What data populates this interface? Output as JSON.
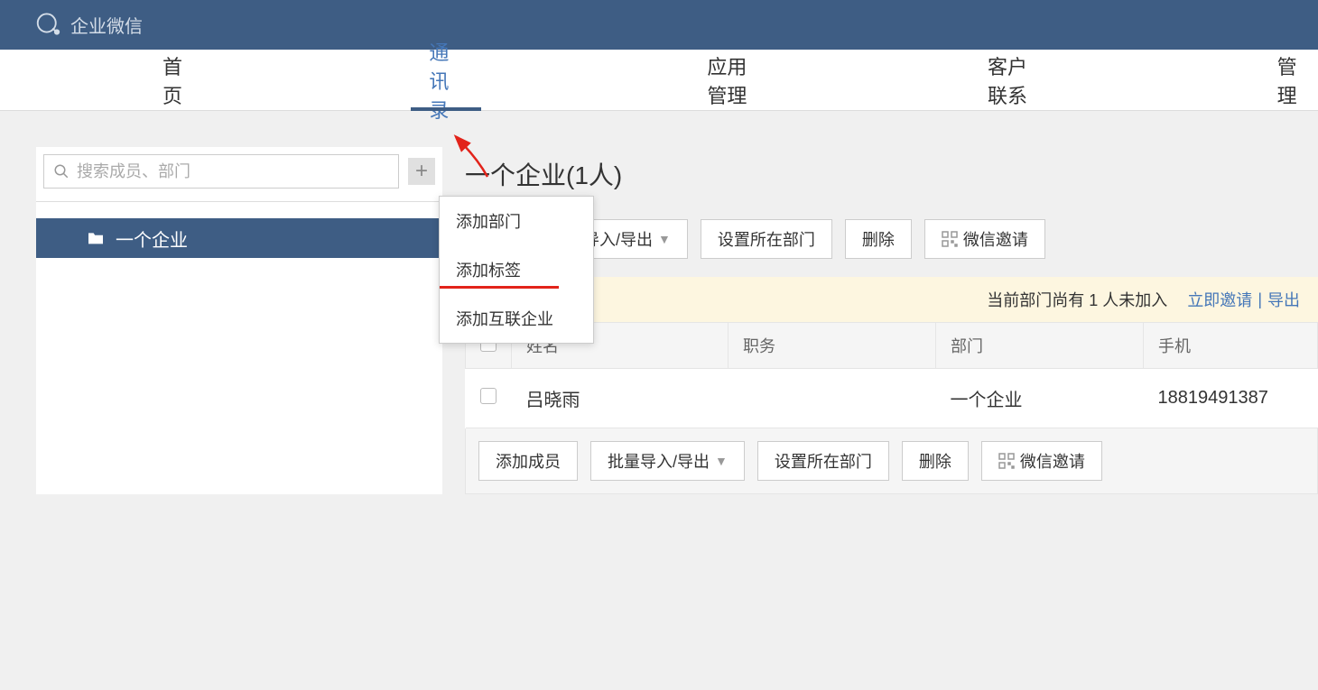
{
  "brand_name": "企业微信",
  "nav": {
    "items": [
      "首页",
      "通讯录",
      "应用管理",
      "客户联系",
      "管理"
    ],
    "active_index": 1
  },
  "sidebar": {
    "search_placeholder": "搜索成员、部门",
    "dept_name": "一个企业",
    "dropdown_items": [
      "添加部门",
      "添加标签",
      "添加互联企业"
    ]
  },
  "content": {
    "title": "一个企业(1人)",
    "buttons": {
      "add_member": "添加成员",
      "import_export": "批量导入/导出",
      "set_dept": "设置所在部门",
      "delete": "删除",
      "wechat_invite": "微信邀请",
      "partial_member_label": "成员"
    },
    "notice": {
      "text": "当前部门尚有 1 人未加入",
      "invite_link": "立即邀请",
      "export_link": "导出"
    },
    "columns": [
      "姓名",
      "职务",
      "部门",
      "手机"
    ],
    "rows": [
      {
        "name": "吕晓雨",
        "title": "",
        "dept": "一个企业",
        "phone": "18819491387"
      }
    ]
  }
}
